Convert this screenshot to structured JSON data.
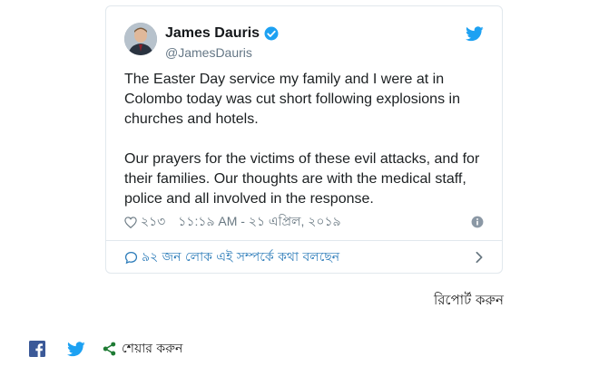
{
  "tweet": {
    "author_name": "James Dauris",
    "author_handle": "@JamesDauris",
    "text": "The Easter Day service my family and I were at in Colombo today was cut short following explosions in churches and hotels.\n\nOur prayers for the victims of these evil attacks, and for their families. Our thoughts are with the medical staff, police and all involved in the response.",
    "likes": "২১৩",
    "timestamp": "১১:১৯ AM - ২১ এপ্রিল, ২০১৯",
    "discussion_label": "৯২ জন লোক এই সম্পর্কে কথা বলছেন"
  },
  "report_label": "রিপোর্ট করুন",
  "share": {
    "label": "শেয়ার করুন"
  },
  "colors": {
    "twitter_blue": "#1da1f2",
    "link_blue": "#2b7bb9",
    "facebook_blue": "#3b5998",
    "share_green": "#1e7b34",
    "meta_gray": "#697882"
  },
  "icons": [
    "verified-icon",
    "twitter-icon",
    "heart-icon",
    "info-icon",
    "chat-icon",
    "chevron-right-icon",
    "facebook-icon",
    "share-icon"
  ]
}
